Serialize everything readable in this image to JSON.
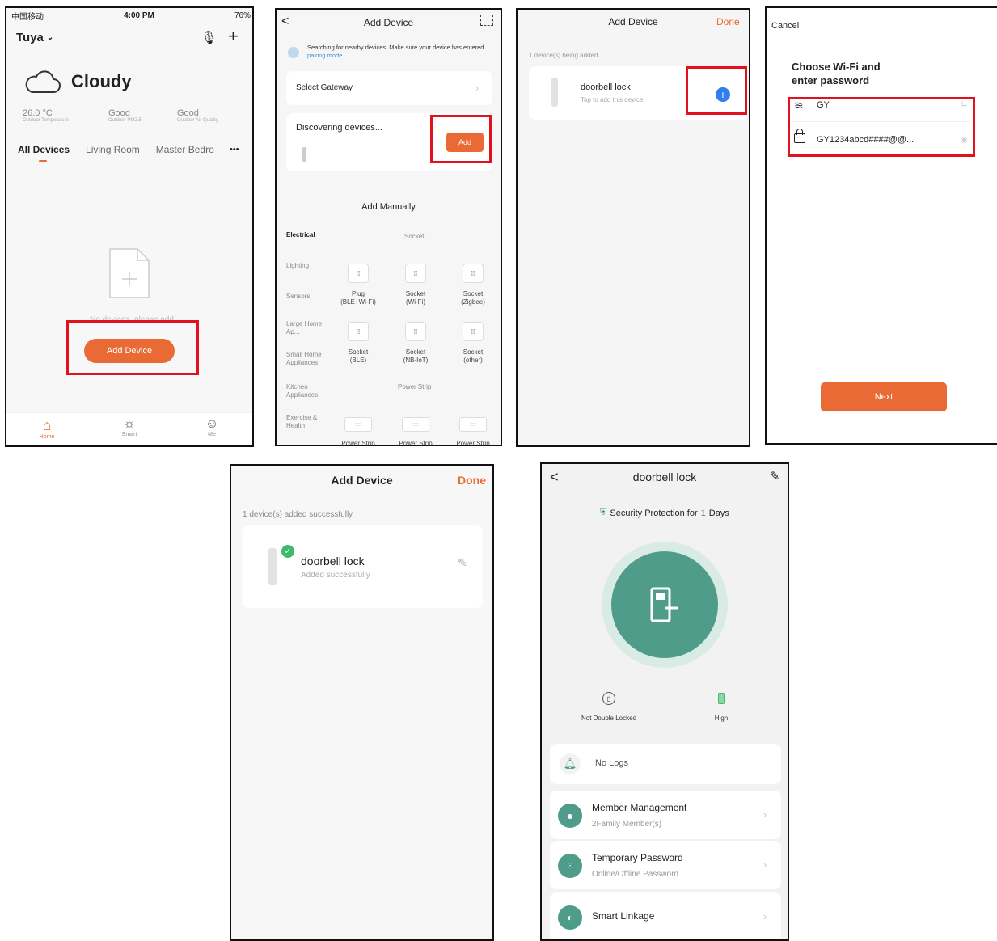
{
  "s1": {
    "status_carrier": "中国移动",
    "status_time": "4:00 PM",
    "status_battery": "76%",
    "home_name": "Tuya",
    "weather": "Cloudy",
    "stats": [
      {
        "value": "26.0 °C",
        "label": "Outdoor Temperature"
      },
      {
        "value": "Good",
        "label": "Outdoor PM2.5"
      },
      {
        "value": "Good",
        "label": "Outdoor Air Quality"
      }
    ],
    "tabs": [
      "All Devices",
      "Living Room",
      "Master Bedro"
    ],
    "more": "•••",
    "empty_text": "No devices, please add",
    "add_button": "Add Device",
    "nav": [
      "Home",
      "Smart",
      "Me"
    ]
  },
  "s2": {
    "title": "Add Device",
    "back": "<",
    "banner_text": "Searching for nearby devices. Make sure your device has entered",
    "banner_link": "pairing mode.",
    "gateway": "Select Gateway",
    "discovering": "Discovering devices...",
    "add": "Add",
    "manual": "Add Manually",
    "categories": [
      "Electrical",
      "Lighting",
      "Sensors",
      "Large Home Ap...",
      "Small Home Appliances",
      "Kitchen Appliances",
      "Exercise & Health"
    ],
    "section_socket": "Socket",
    "socket_row1": [
      "Plug\n(BLE+Wi-Fi)",
      "Socket\n(Wi-Fi)",
      "Socket\n(Zigbee)"
    ],
    "socket_row2": [
      "Socket\n(BLE)",
      "Socket\n(NB-IoT)",
      "Socket\n(other)"
    ],
    "section_strip": "Power Strip",
    "strip_labels": [
      "Power Strip",
      "Power Strip",
      "Power Strip"
    ]
  },
  "s3": {
    "title": "Add Device",
    "done": "Done",
    "count": "1 device(s) being added",
    "device_name": "doorbell lock",
    "device_sub": "Tap to add this device"
  },
  "s4": {
    "cancel": "Cancel",
    "heading": "Choose Wi-Fi and enter password",
    "ssid": "GY",
    "password": "GY1234abcd####@@...",
    "next": "Next"
  },
  "s5": {
    "title": "Add Device",
    "done": "Done",
    "count": "1 device(s) added successfully",
    "device_name": "doorbell lock",
    "device_sub": "Added successfully"
  },
  "s6": {
    "title": "doorbell lock",
    "security_pre": "Security Protection for",
    "security_days": "1",
    "security_post": "Days",
    "status": [
      {
        "label": "Not Double Locked"
      },
      {
        "label": "High"
      }
    ],
    "logs": "No Logs",
    "menu": [
      {
        "title": "Member Management",
        "sub": "2Family Member(s)"
      },
      {
        "title": "Temporary Password",
        "sub": "Online/Offline Password"
      },
      {
        "title": "Smart Linkage",
        "sub": ""
      }
    ]
  },
  "colors": {
    "accent": "#ea6a35",
    "highlight": "#e3101d",
    "lock_teal": "#4f9c8a",
    "link_blue": "#3a8ee6",
    "plus_blue": "#2f7ff0"
  }
}
